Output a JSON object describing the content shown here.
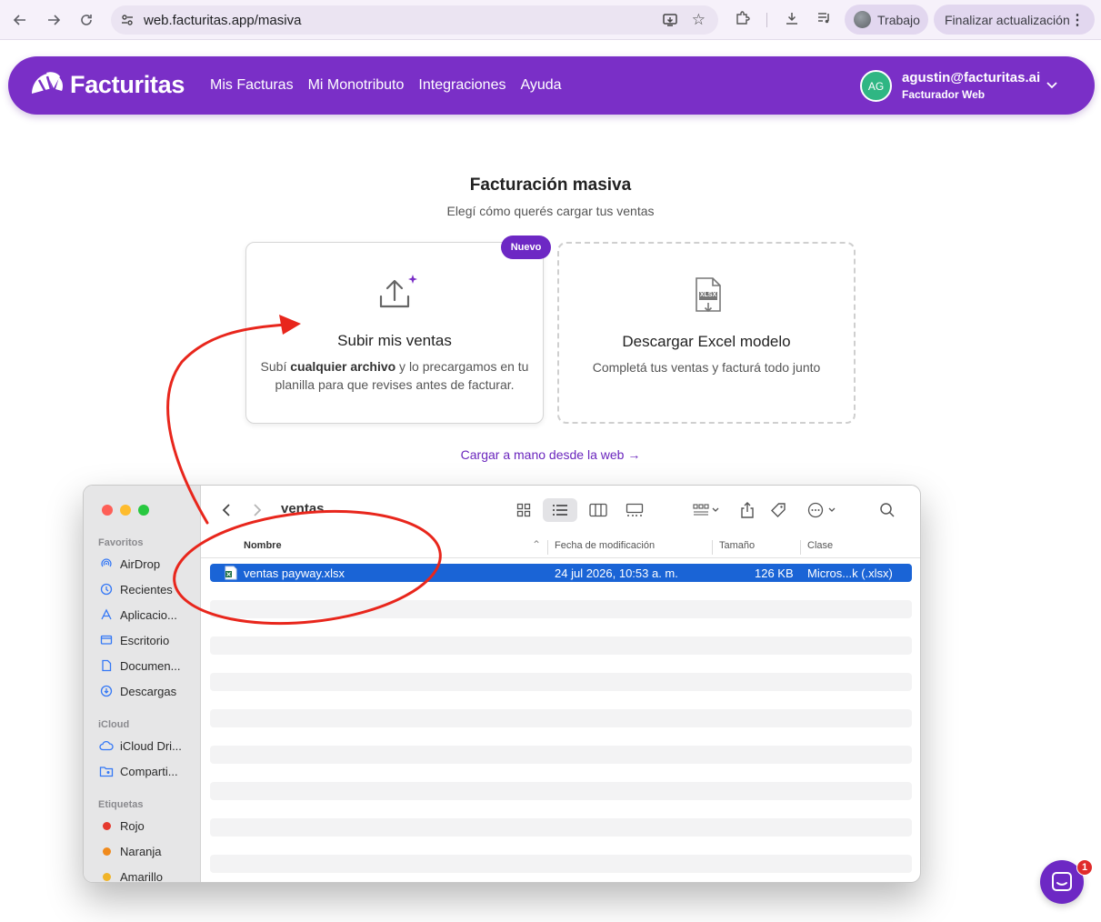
{
  "browser": {
    "url": "web.facturitas.app/masiva",
    "profile_label": "Trabajo",
    "update_label": "Finalizar actualización"
  },
  "header": {
    "brand": "Facturitas",
    "nav": [
      "Mis Facturas",
      "Mi Monotributo",
      "Integraciones",
      "Ayuda"
    ],
    "user_initials": "AG",
    "user_email": "agustin@facturitas.ai",
    "user_role": "Facturador Web"
  },
  "main": {
    "title": "Facturación masiva",
    "subtitle": "Elegí cómo querés cargar tus ventas",
    "upload_card": {
      "badge": "Nuevo",
      "title": "Subir mis ventas",
      "desc_pre": "Subí ",
      "desc_bold": "cualquier archivo",
      "desc_post": " y lo precargamos en tu planilla para que revises antes de facturar."
    },
    "excel_card": {
      "icon_label": "XLSX",
      "title": "Descargar Excel modelo",
      "desc": "Completá tus ventas y facturá todo junto"
    },
    "manual_link": "Cargar a mano desde la web →"
  },
  "finder": {
    "folder": "ventas",
    "sidebar": {
      "favorites_label": "Favoritos",
      "favorites": [
        {
          "label": "AirDrop",
          "icon": "airdrop-icon"
        },
        {
          "label": "Recientes",
          "icon": "clock-icon"
        },
        {
          "label": "Aplicacio...",
          "icon": "apps-icon"
        },
        {
          "label": "Escritorio",
          "icon": "desktop-icon"
        },
        {
          "label": "Documen...",
          "icon": "document-icon"
        },
        {
          "label": "Descargas",
          "icon": "download-icon"
        }
      ],
      "icloud_label": "iCloud",
      "icloud": [
        {
          "label": "iCloud Dri...",
          "icon": "cloud-icon"
        },
        {
          "label": "Comparti...",
          "icon": "shared-folder-icon"
        }
      ],
      "tags_label": "Etiquetas",
      "tags": [
        {
          "label": "Rojo",
          "color": "#e5392e"
        },
        {
          "label": "Naranja",
          "color": "#f08a1c"
        },
        {
          "label": "Amarillo",
          "color": "#f0b429"
        }
      ]
    },
    "columns": [
      "Nombre",
      "Fecha de modificación",
      "Tamaño",
      "Clase"
    ],
    "files": [
      {
        "name": "ventas payway.xlsx",
        "modified": "24 jul 2026, 10:53 a. m.",
        "size": "126 KB",
        "kind": "Micros...k (.xlsx)"
      }
    ]
  },
  "chat": {
    "badge_count": "1"
  },
  "colors": {
    "brand_purple": "#7a2fc7",
    "accent_purple": "#6d28c4",
    "selection_blue": "#1a64d6",
    "annotation_red": "#e8261c"
  }
}
